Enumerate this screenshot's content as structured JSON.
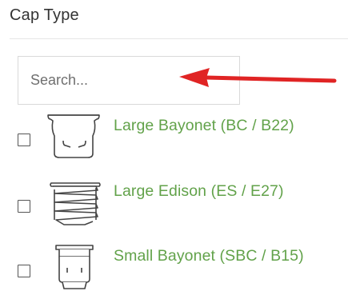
{
  "filter": {
    "title": "Cap Type",
    "search": {
      "placeholder": "Search...",
      "value": ""
    },
    "options": [
      {
        "label": "Large Bayonet (BC / B22)",
        "checked": false,
        "icon": "bayonet-cap-icon"
      },
      {
        "label": "Large Edison (ES / E27)",
        "checked": false,
        "icon": "edison-screw-cap-icon"
      },
      {
        "label": "Small Bayonet (SBC / B15)",
        "checked": false,
        "icon": "small-bayonet-cap-icon"
      }
    ]
  },
  "annotation": {
    "icon": "red-arrow-pointing-left",
    "color": "#e02424"
  },
  "colors": {
    "label": "#62a24a",
    "title": "#333333",
    "border": "#d9d9d9"
  }
}
